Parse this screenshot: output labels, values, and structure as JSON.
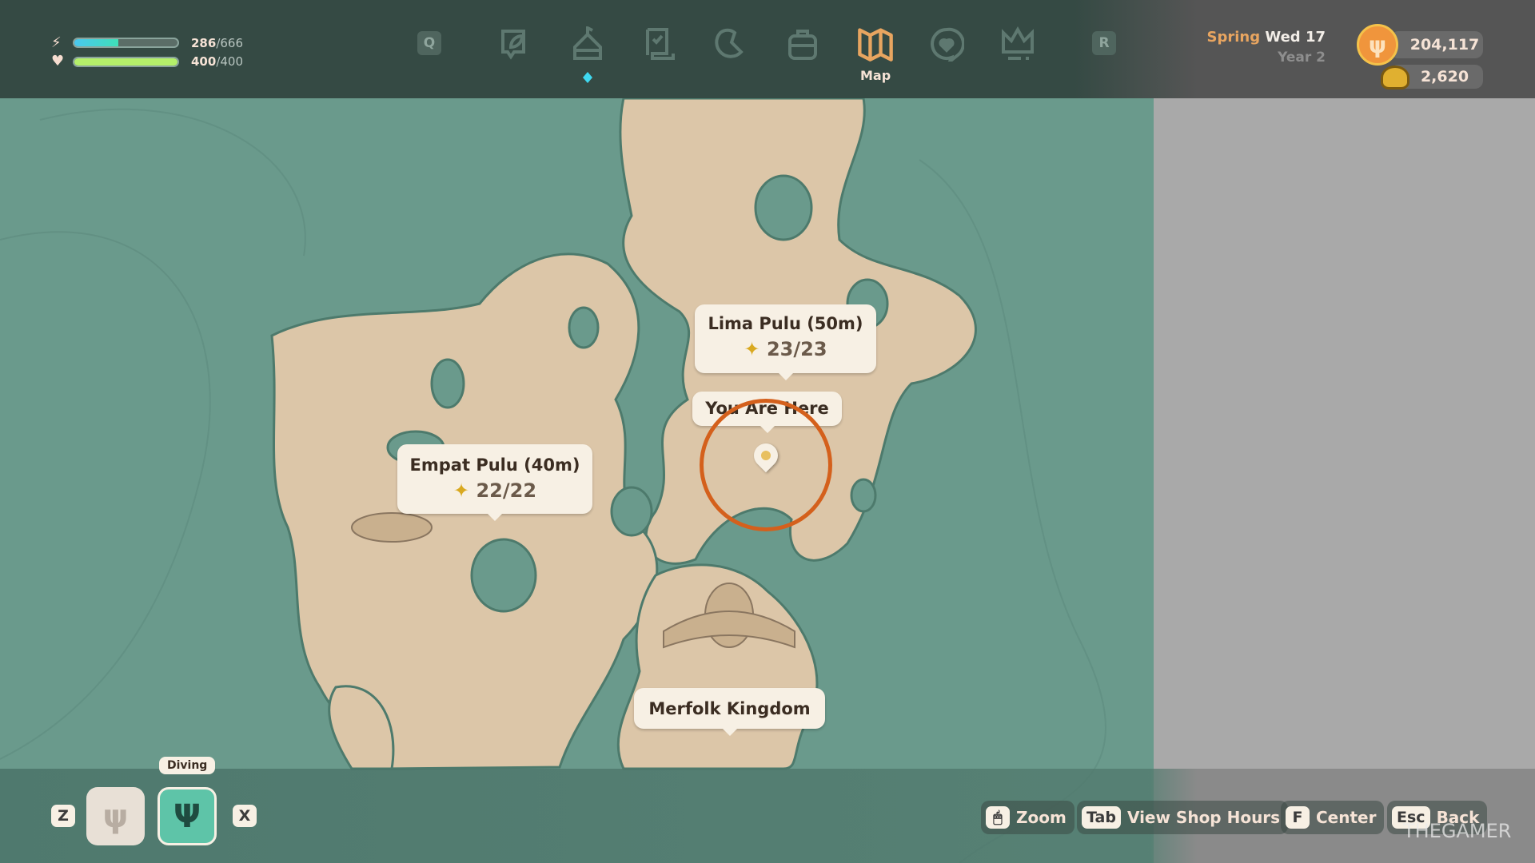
{
  "hud": {
    "energy": {
      "current": "286",
      "max": "666",
      "fraction": 0.43
    },
    "health": {
      "current": "400",
      "max": "400",
      "fraction": 1.0
    }
  },
  "tabs": {
    "left_key": "Q",
    "right_key": "R",
    "items": [
      {
        "icon": "leaf-journal-icon"
      },
      {
        "icon": "house-icon"
      },
      {
        "icon": "scroll-icon"
      },
      {
        "icon": "wrench-icon"
      },
      {
        "icon": "backpack-icon"
      },
      {
        "icon": "map-icon",
        "label": "Map",
        "active": true
      },
      {
        "icon": "heart-chat-icon"
      },
      {
        "icon": "crown-icon"
      }
    ]
  },
  "date": {
    "season": "Spring",
    "day": "Wed 17",
    "year": "Year 2"
  },
  "currency": {
    "coins": "204,117",
    "tickets": "2,620"
  },
  "map": {
    "markers": [
      {
        "name": "Lima Pulu (50m)",
        "count": "23/23"
      },
      {
        "name": "Empat Pulu (40m)",
        "count": "22/22"
      }
    ],
    "you_are_here": "You Are Here",
    "merfolk": "Merfolk Kingdom"
  },
  "tool": {
    "prev_key": "Z",
    "next_key": "X",
    "tooltip": "Diving"
  },
  "hints": [
    {
      "key": "",
      "label": "Zoom"
    },
    {
      "key": "Tab",
      "label": "View Shop Hours"
    },
    {
      "key": "F",
      "label": "Center"
    },
    {
      "key": "Esc",
      "label": "Back"
    }
  ],
  "watermark": "THEGAMER",
  "colors": {
    "sea": "#6a9a8c",
    "sand": "#dcc6a8",
    "accent": "#e8a560",
    "energy": "#3fd8c8",
    "health": "#b4f06a",
    "ring": "#d4601c"
  }
}
